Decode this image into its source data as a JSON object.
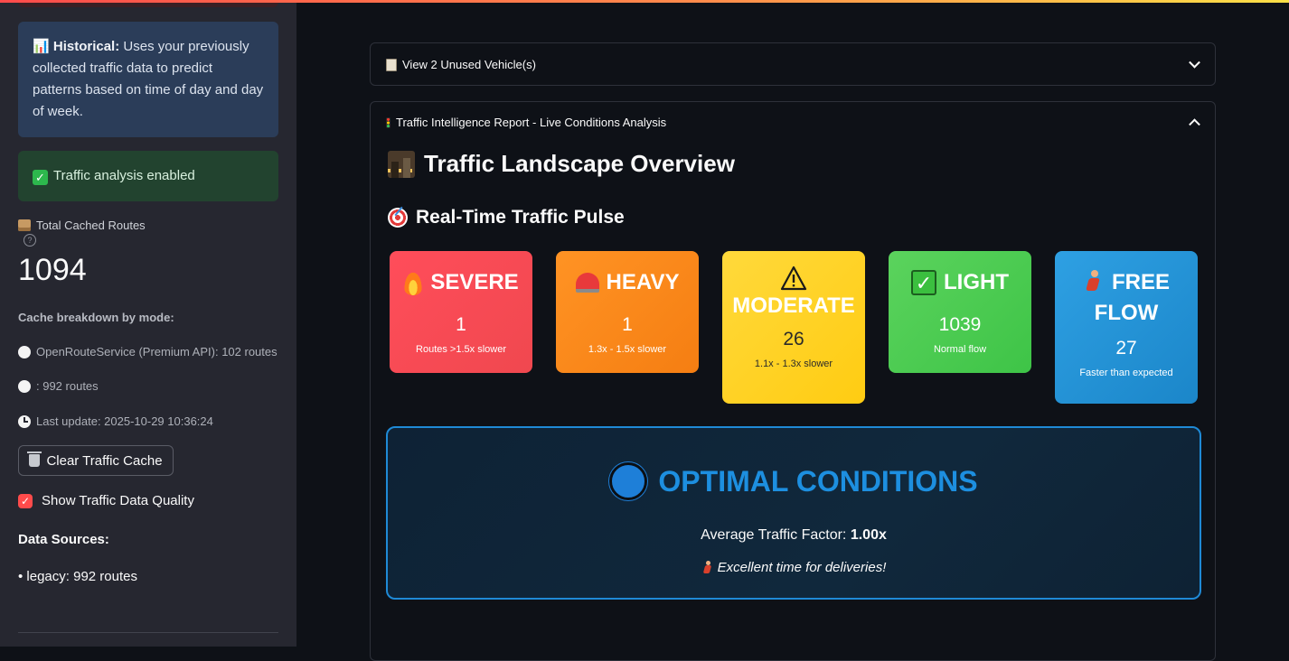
{
  "sidebar": {
    "historical_title": "Historical:",
    "historical_text": "Uses your previously collected traffic data to predict patterns based on time of day and day of week.",
    "success_text": "Traffic analysis enabled",
    "metric_label": "Total Cached Routes",
    "metric_value": "1094",
    "cache_title": "Cache breakdown by mode:",
    "cache_lines": [
      "OpenRouteService (Premium API): 102 routes",
      ": 992 routes"
    ],
    "last_update": "Last update: 2025-10-29 10:36:24",
    "clear_button": "Clear Traffic Cache",
    "checkbox_label": "Show Traffic Data Quality",
    "checkbox_checked": true,
    "data_sources_title": "Data Sources:",
    "data_sources_item": "• legacy: 992 routes"
  },
  "main": {
    "unused_expander": "View 2 Unused Vehicle(s)",
    "report_expander": "Traffic Intelligence Report - Live Conditions Analysis",
    "landscape_title": "Traffic Landscape Overview",
    "pulse_title": "Real-Time Traffic Pulse",
    "cards": [
      {
        "label": "SEVERE",
        "value": "1",
        "sub": "Routes >1.5x slower",
        "icon": "fire-icon",
        "color": "#ff4d5a"
      },
      {
        "label": "HEAVY",
        "value": "1",
        "sub": "1.3x - 1.5x slower",
        "icon": "siren-icon",
        "color": "#ff9324"
      },
      {
        "label": "MODERATE",
        "value": "26",
        "sub": "1.1x - 1.3x slower",
        "icon": "warning-icon",
        "color": "#ffd93b"
      },
      {
        "label": "LIGHT",
        "value": "1039",
        "sub": "Normal flow",
        "icon": "check-icon",
        "color": "#5bd35d"
      },
      {
        "label_line1": "FREE",
        "label_line2": "FLOW",
        "value": "27",
        "sub": "Faster than expected",
        "icon": "runner-icon",
        "color": "#2ea0e3"
      }
    ],
    "optimal": {
      "title": "OPTIMAL CONDITIONS",
      "factor_label": "Average Traffic Factor:",
      "factor_value": "1.00x",
      "note": "Excellent time for deliveries!",
      "accent_color": "#1d8fe0"
    }
  }
}
